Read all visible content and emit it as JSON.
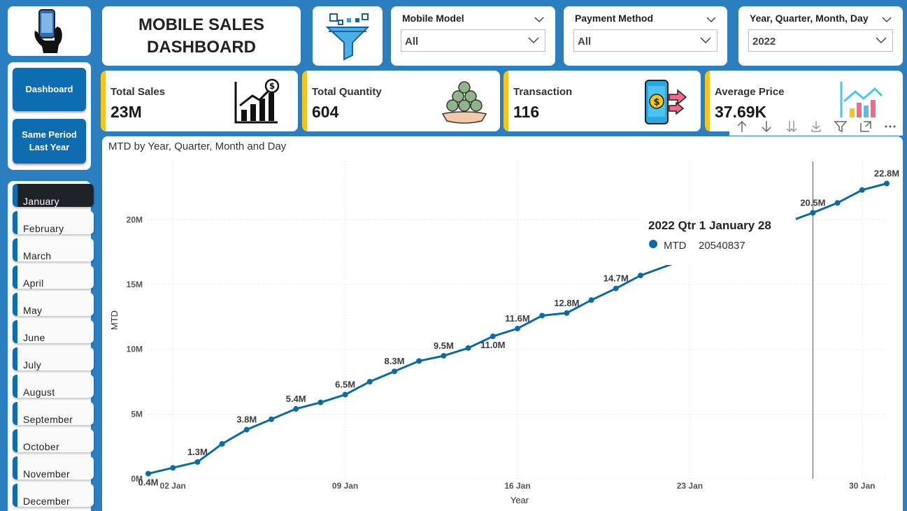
{
  "header": {
    "title_line1": "MOBILE SALES",
    "title_line2": "DASHBOARD"
  },
  "nav": {
    "dashboard_label": "Dashboard",
    "spl_label_line1": "Same Period",
    "spl_label_line2": "Last Year"
  },
  "months": [
    "January",
    "February",
    "March",
    "April",
    "May",
    "June",
    "July",
    "August",
    "September",
    "October",
    "November",
    "December"
  ],
  "selected_month": "January",
  "slicers": {
    "model": {
      "label": "Mobile Model",
      "value": "All"
    },
    "payment": {
      "label": "Payment Method",
      "value": "All"
    },
    "date": {
      "label": "Year, Quarter, Month, Day",
      "value": "2022"
    }
  },
  "kpis": {
    "sales": {
      "label": "Total Sales",
      "value": "23M"
    },
    "qty": {
      "label": "Total Quantity",
      "value": "604"
    },
    "trans": {
      "label": "Transaction",
      "value": "116"
    },
    "price": {
      "label": "Average Price",
      "value": "37.69K"
    }
  },
  "colors": {
    "accent_blue": "#0e6db0",
    "background": "#2b7fc0",
    "kpi_stripe": "#f5c518",
    "line": "#0b6ba5"
  },
  "chart_data": {
    "type": "line",
    "title": "MTD by Year, Quarter, Month and Day",
    "xlabel": "Year",
    "ylabel": "MTD",
    "x_ticks": [
      {
        "day": 2,
        "label": "02 Jan"
      },
      {
        "day": 9,
        "label": "09 Jan"
      },
      {
        "day": 16,
        "label": "16 Jan"
      },
      {
        "day": 23,
        "label": "23 Jan"
      },
      {
        "day": 30,
        "label": "30 Jan"
      }
    ],
    "y_ticks": [
      {
        "value": 0,
        "label": "0M"
      },
      {
        "value": 5000000,
        "label": "5M"
      },
      {
        "value": 10000000,
        "label": "10M"
      },
      {
        "value": 15000000,
        "label": "15M"
      },
      {
        "value": 20000000,
        "label": "20M"
      }
    ],
    "xlim": [
      1,
      31
    ],
    "ylim": [
      0,
      24500000
    ],
    "grid": true,
    "series": [
      {
        "days": [
          1,
          2,
          3,
          4,
          5,
          6,
          7,
          8,
          9,
          10,
          11,
          12,
          13,
          14,
          15,
          16,
          17,
          18,
          19,
          20,
          21,
          28,
          29,
          30,
          31
        ],
        "values": [
          400000,
          850000,
          1300000,
          2700000,
          3800000,
          4600000,
          5400000,
          5900000,
          6500000,
          7500000,
          8300000,
          9100000,
          9500000,
          10100000,
          11000000,
          11600000,
          12600000,
          12800000,
          13800000,
          14700000,
          15700000,
          20540837,
          21300000,
          22300000,
          22800000
        ]
      }
    ],
    "data_labels": [
      {
        "day": 1,
        "text": "0.4M",
        "pos": "below"
      },
      {
        "day": 3,
        "text": "1.3M",
        "pos": "above"
      },
      {
        "day": 5,
        "text": "3.8M",
        "pos": "above"
      },
      {
        "day": 7,
        "text": "5.4M",
        "pos": "above"
      },
      {
        "day": 9,
        "text": "6.5M",
        "pos": "above"
      },
      {
        "day": 11,
        "text": "8.3M",
        "pos": "above"
      },
      {
        "day": 13,
        "text": "9.5M",
        "pos": "above"
      },
      {
        "day": 15,
        "text": "11.0M",
        "pos": "below"
      },
      {
        "day": 16,
        "text": "11.6M",
        "pos": "above"
      },
      {
        "day": 18,
        "text": "12.8M",
        "pos": "above"
      },
      {
        "day": 20,
        "text": "14.7M",
        "pos": "above"
      },
      {
        "day": 28,
        "text": "20.5M",
        "pos": "above"
      },
      {
        "day": 31,
        "text": "22.8M",
        "pos": "above"
      }
    ],
    "tooltip": {
      "day": 28,
      "title": "2022 Qtr 1 January 28",
      "series_name": "MTD",
      "value": "20540837"
    }
  }
}
